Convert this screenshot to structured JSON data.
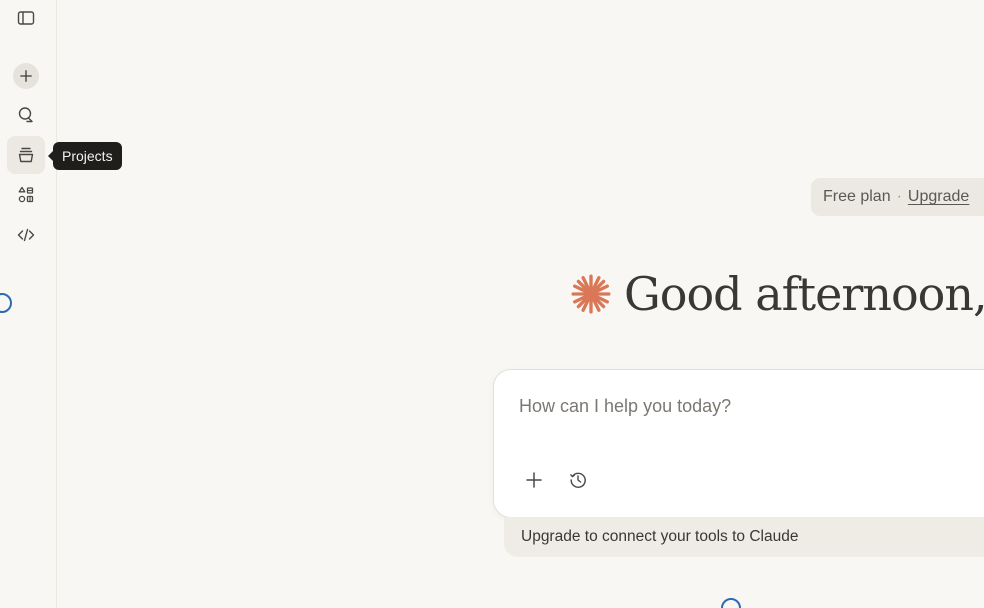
{
  "sidebar": {
    "toggle_icon": "sidebar-toggle-icon",
    "items": [
      {
        "name": "new-chat",
        "icon": "plus-icon"
      },
      {
        "name": "chats",
        "icon": "chat-bubbles-icon"
      },
      {
        "name": "projects",
        "icon": "projects-stack-icon"
      },
      {
        "name": "artifacts",
        "icon": "artifacts-grid-icon"
      },
      {
        "name": "code",
        "icon": "code-icon"
      }
    ],
    "tooltip": "Projects"
  },
  "plan": {
    "label": "Free plan",
    "separator": "·",
    "upgrade": "Upgrade"
  },
  "greeting": {
    "text": "Good afternoon,",
    "logo_icon": "claude-spark-icon",
    "accent_color": "#d97757"
  },
  "composer": {
    "placeholder": "How can I help you today?",
    "value": "",
    "add_icon": "plus-icon",
    "history_icon": "clock-history-icon"
  },
  "banner": {
    "text": "Upgrade to connect your tools to Claude"
  }
}
